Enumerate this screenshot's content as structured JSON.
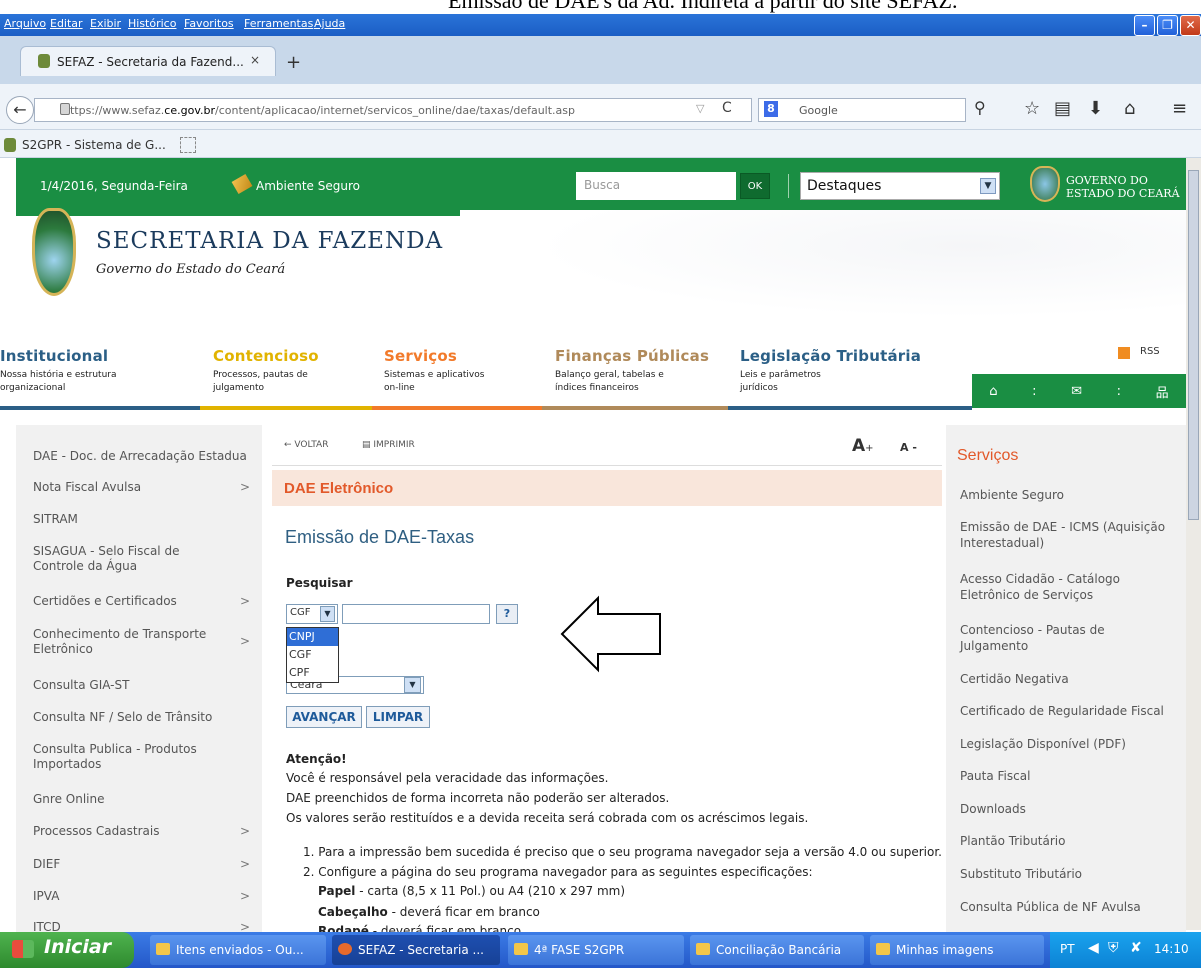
{
  "caption": "Emissão de DAE's da Ad. Indireta a partir do site SEFAZ.",
  "menubar": [
    "Arquivo",
    "Editar",
    "Exibir",
    "Histórico",
    "Favoritos",
    "Ferramentas",
    "Ajuda"
  ],
  "tab": {
    "title": "SEFAZ - Secretaria da Fazend...",
    "close": "×",
    "new": "+"
  },
  "nav": {
    "url_prefix": "https://www.sefaz.",
    "url_domain": "ce.gov.br",
    "url_rest": "/content/aplicacao/internet/servicos_online/dae/taxas/default.asp",
    "search_engine": "Google"
  },
  "bookmark": "S2GPR - Sistema de G...",
  "topbar": {
    "date": "1/4/2016, Segunda-Feira",
    "secure": "Ambiente Seguro",
    "search_placeholder": "Busca",
    "ok": "OK",
    "destaques": "Destaques",
    "gov_line1": "GOVERNO DO",
    "gov_line2": "ESTADO DO CEARÁ"
  },
  "header": {
    "title": "SECRETARIA DA FAZENDA",
    "subtitle": "Governo do Estado do Ceará"
  },
  "mainnav": [
    {
      "title": "Institucional",
      "desc1": "Nossa história e estrutura",
      "desc2": "organizacional",
      "color": "#2b5f86"
    },
    {
      "title": "Contencioso",
      "desc1": "Processos, pautas de",
      "desc2": "julgamento",
      "color": "#e1b300"
    },
    {
      "title": "Serviços",
      "desc1": "Sistemas e aplicativos",
      "desc2": "on-line",
      "color": "#f27a2a"
    },
    {
      "title": "Finanças Públicas",
      "desc1": "Balanço geral, tabelas e",
      "desc2": "índices financeiros",
      "color": "#b08a5a"
    },
    {
      "title": "Legislação Tributária",
      "desc1": "Leis e parâmetros",
      "desc2": "jurídicos",
      "color": "#2b5f86"
    }
  ],
  "rss": "RSS",
  "leftmenu": [
    {
      "label": "DAE - Doc. de Arrecadação Estadual",
      "arrow": ""
    },
    {
      "label": "Nota Fiscal Avulsa",
      "arrow": ">"
    },
    {
      "label": "SITRAM",
      "arrow": ""
    },
    {
      "label": "SISAGUA - Selo Fiscal de Controle da Água",
      "arrow": ""
    },
    {
      "label": "Certidões e Certificados",
      "arrow": ">"
    },
    {
      "label": "Conhecimento de Transporte Eletrônico",
      "arrow": ">"
    },
    {
      "label": "Consulta GIA-ST",
      "arrow": ""
    },
    {
      "label": "Consulta NF / Selo de Trânsito",
      "arrow": ""
    },
    {
      "label": "Consulta Publica - Produtos Importados",
      "arrow": ""
    },
    {
      "label": "Gnre Online",
      "arrow": ""
    },
    {
      "label": "Processos Cadastrais",
      "arrow": ">"
    },
    {
      "label": "DIEF",
      "arrow": ">"
    },
    {
      "label": "IPVA",
      "arrow": ">"
    },
    {
      "label": "ITCD",
      "arrow": ">"
    }
  ],
  "content": {
    "voltar": "← VOLTAR",
    "imprimir": "IMPRIMIR",
    "aplus": "A",
    "aplus_sign": "+",
    "aminus": "A -",
    "section": "DAE Eletrônico",
    "heading": "Emissão de DAE-Taxas",
    "search_label": "Pesquisar",
    "doc_selected": "CGF",
    "help": "?",
    "doc_options": [
      "CNPJ",
      "CGF",
      "CPF"
    ],
    "uf": "Ceará",
    "btn_next": "AVANÇAR",
    "btn_clear": "LIMPAR",
    "attention": "Atenção!",
    "notes": [
      "Você é responsável pela veracidade das informações.",
      "DAE preenchidos de forma incorreta não poderão ser alterados.",
      "Os valores serão restituídos e a devida receita será cobrada com os acréscimos legais."
    ],
    "list1": "1. Para a impressão bem sucedida é preciso que o seu programa navegador seja a versão 4.0 ou superior.",
    "list2": "2. Configure a página do seu programa navegador para as seguintes especificações:",
    "paper_b": "Papel",
    "paper_t": " - carta (8,5 x 11 Pol.) ou A4 (210 x 297 mm)",
    "head_b": "Cabeçalho",
    "head_t": " - deverá ficar em branco",
    "foot_b": "Rodapé",
    "foot_t": " - deverá ficar em branco"
  },
  "rightmenu": {
    "title": "Serviços",
    "items": [
      "Ambiente Seguro",
      "Emissão de DAE - ICMS (Aquisição Interestadual)",
      "Acesso Cidadão - Catálogo Eletrônico de Serviços",
      "Contencioso - Pautas de Julgamento",
      "Certidão Negativa",
      "Certificado de Regularidade Fiscal",
      "Legislação Disponível (PDF)",
      "Pauta Fiscal",
      "Downloads",
      "Plantão Tributário",
      "Substituto Tributário",
      "Consulta Pública de NF Avulsa"
    ]
  },
  "taskbar": {
    "start": "Iniciar",
    "tasks": [
      "Itens enviados - Ou...",
      "SEFAZ - Secretaria ...",
      "4ª FASE S2GPR",
      "Conciliação Bancária",
      "Minhas imagens"
    ],
    "lang": "PT",
    "time": "14:10"
  }
}
